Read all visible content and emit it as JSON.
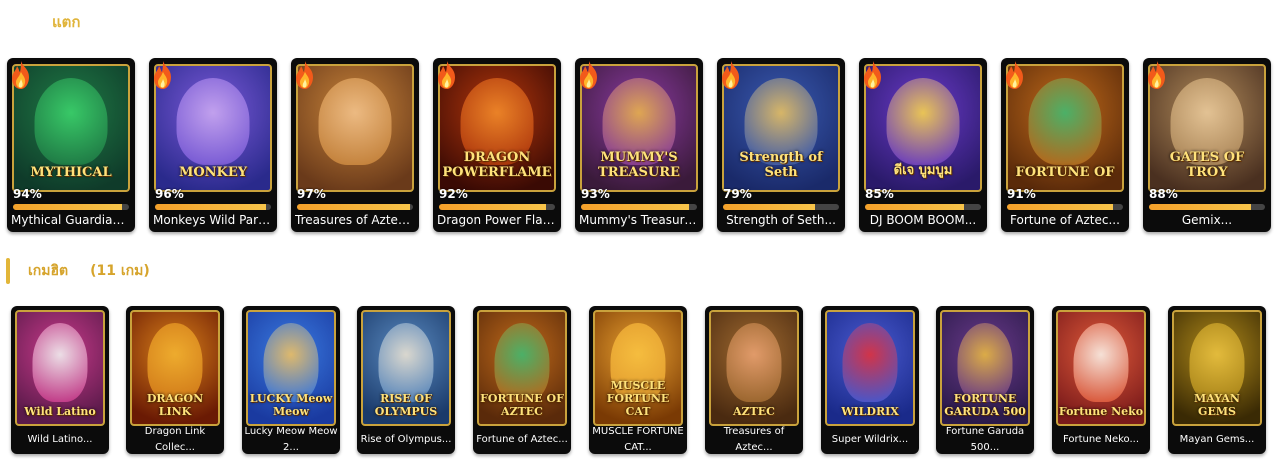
{
  "header": {
    "label": "แตก"
  },
  "section": {
    "title": "เกมฮิต",
    "count": "(11 เกม)"
  },
  "top_games": [
    {
      "name": "Mythical Guardians...",
      "rtp": "94%",
      "rtp_value": 94,
      "art_title": "MYTHICAL",
      "bg1": "#0f3b2a",
      "bg2": "#1f7a45",
      "fig": "#3bd16b"
    },
    {
      "name": "Monkeys Wild Party...",
      "rtp": "96%",
      "rtp_value": 96,
      "art_title": "MONKEY",
      "bg1": "#2a2a8c",
      "bg2": "#7a5ad8",
      "fig": "#c9a8f0"
    },
    {
      "name": "Treasures of Aztec...",
      "rtp": "97%",
      "rtp_value": 97,
      "art_title": "",
      "bg1": "#6a3a1a",
      "bg2": "#c8843a",
      "fig": "#f0c08a"
    },
    {
      "name": "Dragon Power Flame...",
      "rtp": "92%",
      "rtp_value": 92,
      "art_title": "DRAGON POWERFLAME",
      "bg1": "#3a0a04",
      "bg2": "#b4370c",
      "fig": "#f08a2a"
    },
    {
      "name": "Mummy's Treasure Q...",
      "rtp": "93%",
      "rtp_value": 93,
      "art_title": "MUMMY'S TREASURE",
      "bg1": "#3a1a3a",
      "bg2": "#8a3aa0",
      "fig": "#e8b24a"
    },
    {
      "name": "Strength of Seth...",
      "rtp": "79%",
      "rtp_value": 79,
      "art_title": "Strength of Seth",
      "bg1": "#1a2a6a",
      "bg2": "#3a5ab0",
      "fig": "#e8c060"
    },
    {
      "name": "DJ BOOM BOOM...",
      "rtp": "85%",
      "rtp_value": 85,
      "art_title": "ดีเจ บูมบูม",
      "bg1": "#2a1a6a",
      "bg2": "#6a3ac8",
      "fig": "#f7d34a"
    },
    {
      "name": "Fortune of Aztec...",
      "rtp": "91%",
      "rtp_value": 91,
      "art_title": "FORTUNE OF",
      "bg1": "#5a2a0a",
      "bg2": "#c06a1a",
      "fig": "#3fb870"
    },
    {
      "name": "Gemix...",
      "rtp": "88%",
      "rtp_value": 88,
      "art_title": "GATES OF TROY",
      "bg1": "#4a3020",
      "bg2": "#b08a5a",
      "fig": "#e8c89a"
    }
  ],
  "hit_games": [
    {
      "name": "Wild Latino...",
      "name2": "",
      "art_title": "Wild Latino",
      "bg1": "#5a1a4a",
      "bg2": "#c83a8a",
      "fig": "#f0f0f0"
    },
    {
      "name": "Dragon Link Collec...",
      "name2": "",
      "art_title": "DRAGON LINK",
      "bg1": "#6a1a04",
      "bg2": "#d8801a",
      "fig": "#f0b030"
    },
    {
      "name": "Lucky Meow Meow",
      "name2": "2...",
      "art_title": "LUCKY Meow Meow",
      "bg1": "#1a3aa0",
      "bg2": "#3a7ae0",
      "fig": "#f0c060"
    },
    {
      "name": "Rise of Olympus...",
      "name2": "",
      "art_title": "RISE OF OLYMPUS",
      "bg1": "#1a3a6a",
      "bg2": "#5a8ac0",
      "fig": "#e8e0d0"
    },
    {
      "name": "Fortune of Aztec...",
      "name2": "",
      "art_title": "FORTUNE OF AZTEC",
      "bg1": "#5a2a0a",
      "bg2": "#c06a1a",
      "fig": "#3fb870"
    },
    {
      "name": "MUSCLE FORTUNE",
      "name2": "CAT...",
      "art_title": "MUSCLE FORTUNE CAT",
      "bg1": "#7a3a04",
      "bg2": "#e8a030",
      "fig": "#f7c040"
    },
    {
      "name": "Treasures of Aztec...",
      "name2": "",
      "art_title": "AZTEC",
      "bg1": "#4a2a10",
      "bg2": "#a06a30",
      "fig": "#e8a070"
    },
    {
      "name": "Super Wildrix...",
      "name2": "",
      "art_title": "WILDRIX",
      "bg1": "#1a2a8a",
      "bg2": "#4a5ad0",
      "fig": "#e0303a"
    },
    {
      "name": "Fortune Garuda",
      "name2": "500...",
      "art_title": "FORTUNE GARUDA 500",
      "bg1": "#2a1a4a",
      "bg2": "#6a3a8a",
      "fig": "#e8b840"
    },
    {
      "name": "Fortune Neko...",
      "name2": "",
      "art_title": "Fortune Neko",
      "bg1": "#7a1a1a",
      "bg2": "#e05a3a",
      "fig": "#f8f0e8"
    },
    {
      "name": "Mayan Gems...",
      "name2": "",
      "art_title": "MAYAN GEMS",
      "bg1": "#3a2a04",
      "bg2": "#b08a1a",
      "fig": "#e8c040"
    }
  ]
}
